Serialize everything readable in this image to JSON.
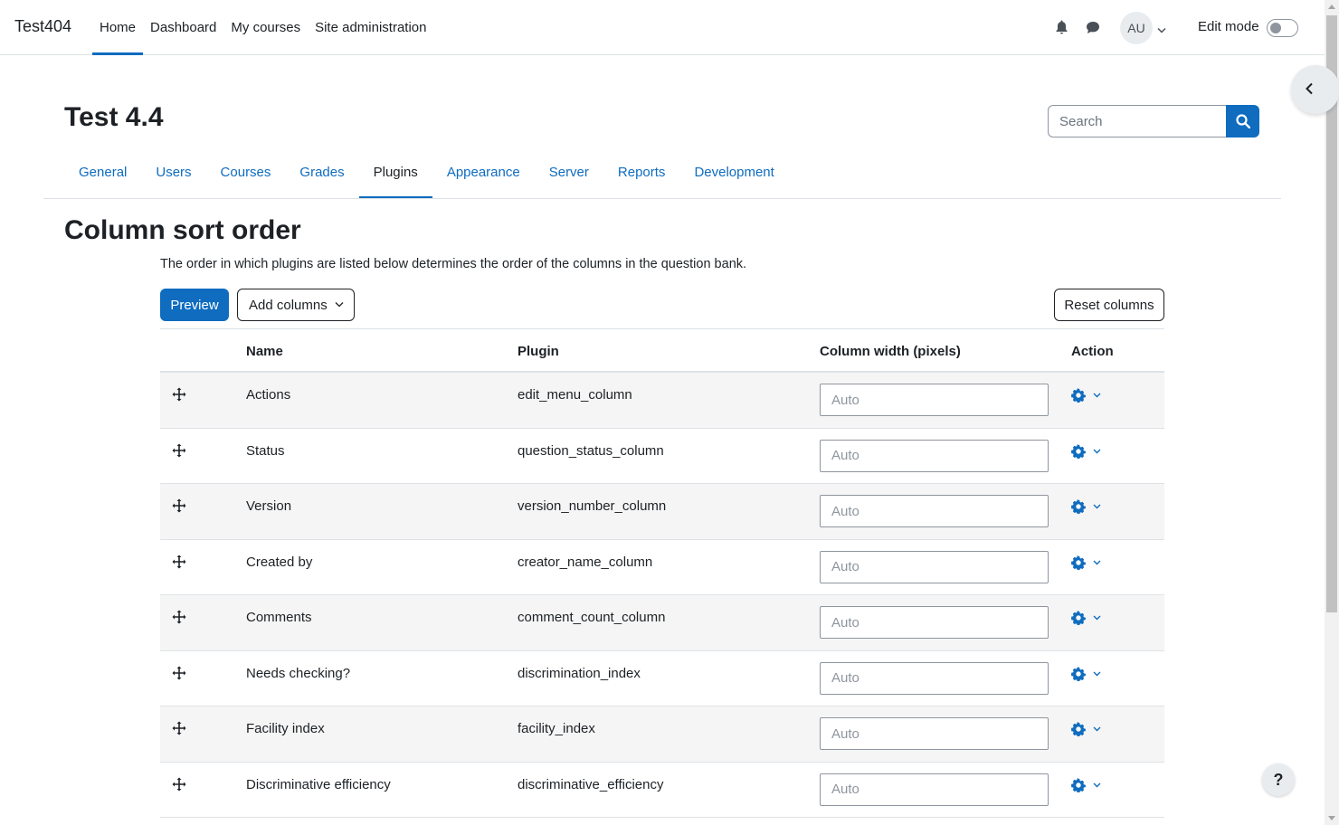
{
  "site_name": "Test404",
  "primary_nav": [
    {
      "label": "Home",
      "active": true
    },
    {
      "label": "Dashboard",
      "active": false
    },
    {
      "label": "My courses",
      "active": false
    },
    {
      "label": "Site administration",
      "active": false
    }
  ],
  "user": {
    "initials": "AU"
  },
  "edit_mode": {
    "label": "Edit mode",
    "enabled": false
  },
  "header": {
    "title": "Test 4.4"
  },
  "search": {
    "placeholder": "Search",
    "value": ""
  },
  "secondary_nav": [
    {
      "label": "General",
      "active": false
    },
    {
      "label": "Users",
      "active": false
    },
    {
      "label": "Courses",
      "active": false
    },
    {
      "label": "Grades",
      "active": false
    },
    {
      "label": "Plugins",
      "active": true
    },
    {
      "label": "Appearance",
      "active": false
    },
    {
      "label": "Server",
      "active": false
    },
    {
      "label": "Reports",
      "active": false
    },
    {
      "label": "Development",
      "active": false
    }
  ],
  "main": {
    "heading": "Column sort order",
    "description": "The order in which plugins are listed below determines the order of the columns in the question bank.",
    "preview_label": "Preview",
    "add_columns_label": "Add columns",
    "reset_label": "Reset columns"
  },
  "table": {
    "headers": {
      "name": "Name",
      "plugin": "Plugin",
      "width": "Column width (pixels)",
      "action": "Action"
    },
    "input_placeholder": "Auto",
    "rows": [
      {
        "name": "Actions",
        "plugin": "edit_menu_column"
      },
      {
        "name": "Status",
        "plugin": "question_status_column"
      },
      {
        "name": "Version",
        "plugin": "version_number_column"
      },
      {
        "name": "Created by",
        "plugin": "creator_name_column"
      },
      {
        "name": "Comments",
        "plugin": "comment_count_column"
      },
      {
        "name": "Needs checking?",
        "plugin": "discrimination_index"
      },
      {
        "name": "Facility index",
        "plugin": "facility_index"
      },
      {
        "name": "Discriminative efficiency",
        "plugin": "discriminative_efficiency"
      }
    ]
  },
  "help": {
    "label": "?"
  },
  "colors": {
    "primary": "#0f6cbf",
    "text": "#1d2125",
    "row_stripe": "#f5f5f5"
  }
}
